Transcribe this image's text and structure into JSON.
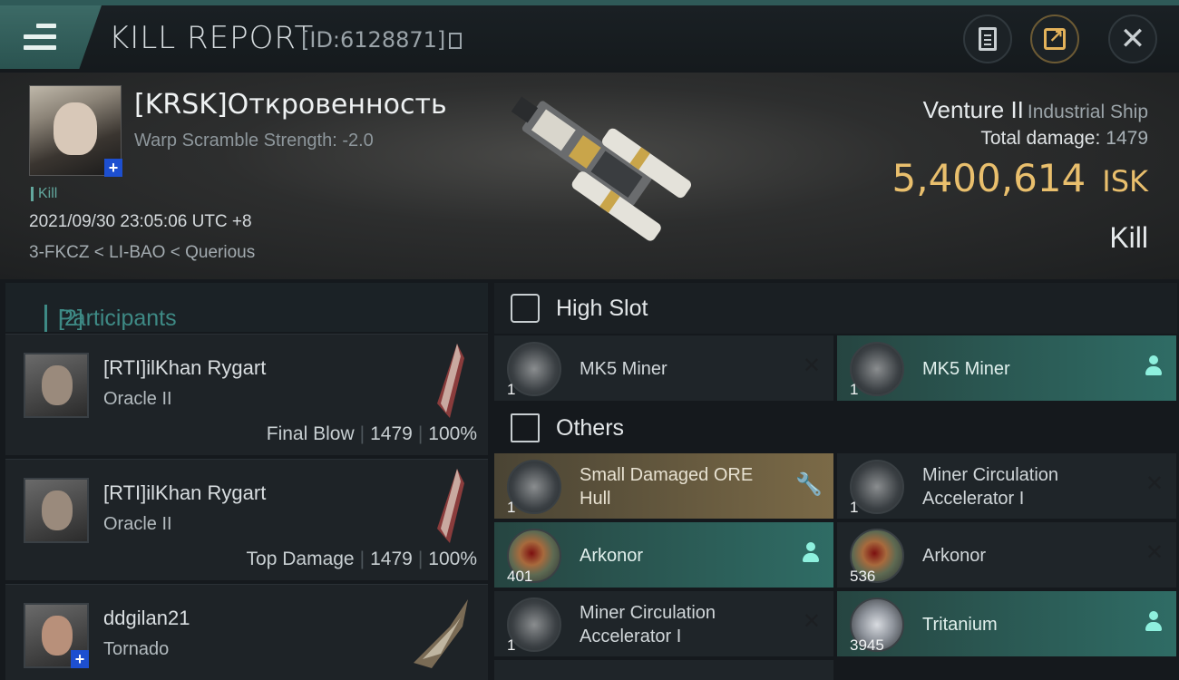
{
  "header": {
    "title": "KILL REPORT",
    "id_text": "[ID:6128871]"
  },
  "victim": {
    "name": "[KRSK]Откровенность",
    "warp_scramble": "Warp Scramble Strength: -2.0",
    "tag": "Kill",
    "datetime": "2021/09/30 23:05:06 UTC +8",
    "location": "3-FKCZ < LI-BAO < Querious"
  },
  "ship": {
    "name": "Venture II",
    "class": "Industrial Ship",
    "total_damage_label": "Total damage:",
    "total_damage": "1479",
    "isk_value": "5,400,614",
    "isk_unit": "ISK",
    "result": "Kill"
  },
  "participants": {
    "label": "Participants",
    "count": "[2]",
    "rows": [
      {
        "name": "[RTI]ilKhan Rygart",
        "ship": "Oracle II",
        "role": "Final Blow",
        "damage": "1479",
        "percent": "100%"
      },
      {
        "name": "[RTI]ilKhan Rygart",
        "ship": "Oracle II",
        "role": "Top Damage",
        "damage": "1479",
        "percent": "100%"
      },
      {
        "name": "ddgilan21",
        "ship": "Tornado"
      }
    ]
  },
  "high_slot": {
    "label": "High Slot",
    "items": [
      {
        "qty": "1",
        "name": "MK5 Miner",
        "status": "destroyed"
      },
      {
        "qty": "1",
        "name": "MK5 Miner",
        "status": "dropped"
      }
    ]
  },
  "others": {
    "label": "Others",
    "items": [
      {
        "qty": "1",
        "name_line1": "Small Damaged ORE",
        "name_line2": "Hull",
        "status": "salvage"
      },
      {
        "qty": "1",
        "name_line1": "Miner Circulation",
        "name_line2": "Accelerator I",
        "status": "destroyed"
      },
      {
        "qty": "401",
        "name": "Arkonor",
        "status": "dropped"
      },
      {
        "qty": "536",
        "name": "Arkonor",
        "status": "destroyed"
      },
      {
        "qty": "1",
        "name_line1": "Miner Circulation",
        "name_line2": "Accelerator I",
        "status": "destroyed"
      },
      {
        "qty": "3945",
        "name": "Tritanium",
        "status": "dropped"
      }
    ]
  },
  "colors": {
    "accent_teal": "#3e8a85",
    "isk_gold": "#e9bf6d",
    "dropped_bg": "#2f6c65",
    "salvage_bg": "#7b6a47"
  }
}
